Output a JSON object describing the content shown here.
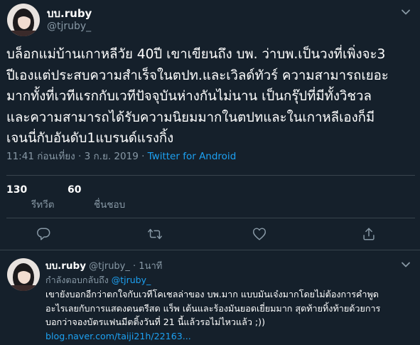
{
  "main_tweet": {
    "display_name": "บบ.ruby",
    "handle": "@tjruby_",
    "text_lines": [
      "บล็อกแม่บ้านเกาหลีวัย 40ปี เขาเขียนถึง บพ. ว่าบพ.เป็นวงที่เพิ่งจะ3",
      "ปีเองแต่ประสบความสำเร็จในตปท.และเวิลด์ทัวร์ ความสามารถเยอะ",
      "มากทั้งที่เวทีแรกกับเวทีปัจจุบันห่างกันไม่นาน เป็นกรุ๊ปที่มีทั้งวิชวล",
      "และความสามารถได้รับความนิยมมากในตปทและในเกาหลีเองก็มี",
      "เจนนี่กับอันดับ1แบรนด์แรงกิ้ง"
    ],
    "timestamp": "11:41 ก่อนเที่ยง · 3 ก.ย. 2019",
    "separator": " · ",
    "client": "Twitter for Android",
    "retweets_count": "130",
    "retweets_label": "รีทวีต",
    "likes_count": "60",
    "likes_label": "ชื่นชอบ"
  },
  "reply_tweet": {
    "display_name": "บบ.ruby",
    "handle": "@tjruby_",
    "time": "1นาที",
    "separator": " · ",
    "replying_prefix": "กำลังตอบกลับถึง ",
    "replying_mention": "@tjruby_",
    "text_lines": [
      "เขายังบอกอีกว่าตกใจกับเวทีโคเชลล่าของ บพ.มาก แบบมันเจ๋งมากโดยไม่ต้องการคำพูด",
      "อะไรเลยกับการแสดงดนตรีสด แร็พ เต้นและร้องมันยอดเยี่ยมมาก สุดท้ายทิ้งท้ายด้วยการ",
      "บอกว่าจองบัตรแฟนมีตติ้งวันที่ 21 นี้แล้วรอไม่ไหวแล้ว ;))"
    ],
    "link": "blog.naver.com/taiji21h/22163..."
  },
  "icons": {
    "chevron": "chevron-down-icon",
    "reply": "reply-icon",
    "retweet": "retweet-icon",
    "like": "heart-icon",
    "share": "share-icon"
  },
  "colors": {
    "background": "#15202b",
    "secondary_text": "#8899a6",
    "accent": "#1da1f2",
    "divider": "#38444d"
  }
}
